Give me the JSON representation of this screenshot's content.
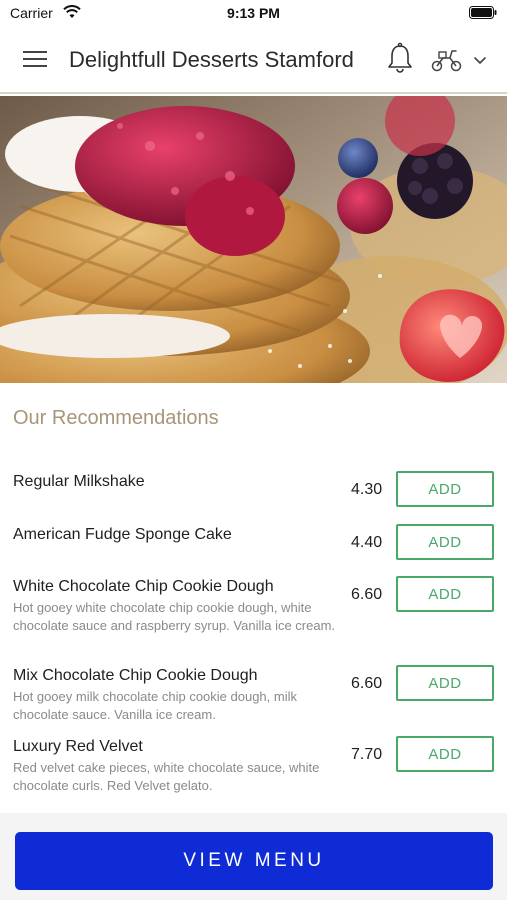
{
  "status_bar": {
    "carrier": "Carrier",
    "time": "9:13 PM"
  },
  "header": {
    "title": "Delightfull Desserts Stamford"
  },
  "recommendations": {
    "heading": "Our Recommendations",
    "add_label": "ADD",
    "items": [
      {
        "name": "Regular Milkshake",
        "description": "",
        "price": "4.30"
      },
      {
        "name": "American Fudge Sponge Cake",
        "description": "",
        "price": "4.40"
      },
      {
        "name": "White Chocolate Chip Cookie Dough",
        "description": "Hot gooey white chocolate chip cookie dough, white chocolate sauce and raspberry syrup. Vanilla ice cream.",
        "price": "6.60"
      },
      {
        "name": "Mix Chocolate Chip Cookie Dough",
        "description": "Hot gooey milk chocolate chip cookie dough, milk chocolate sauce. Vanilla ice cream.",
        "price": "6.60"
      },
      {
        "name": "Luxury Red Velvet",
        "description": "Red velvet cake pieces, white chocolate sauce, white chocolate curls. Red Velvet gelato.",
        "price": "7.70"
      }
    ]
  },
  "footer": {
    "view_menu_label": "VIEW MENU"
  },
  "icons": {
    "menu": "hamburger-icon",
    "notifications": "bell-icon",
    "delivery": "scooter-icon",
    "dropdown": "chevron-down-icon"
  },
  "colors": {
    "accent_gold": "#a89579",
    "add_green": "#4aa86a",
    "primary_blue": "#0f2bd6"
  }
}
